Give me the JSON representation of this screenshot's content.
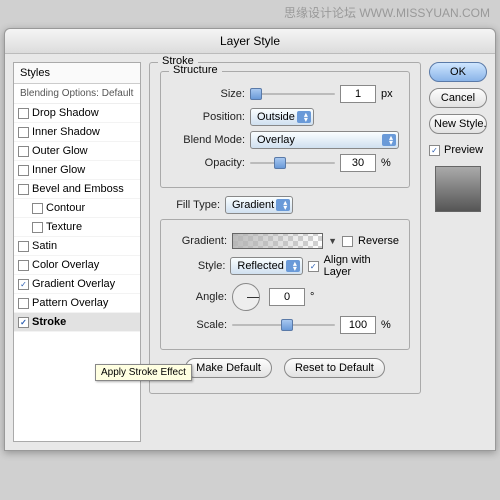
{
  "watermark": "思缘设计论坛 WWW.MISSYUAN.COM",
  "windowTitle": "Layer Style",
  "styles": {
    "header": "Styles",
    "sub": "Blending Options: Default",
    "items": [
      {
        "label": "Drop Shadow",
        "checked": false
      },
      {
        "label": "Inner Shadow",
        "checked": false
      },
      {
        "label": "Outer Glow",
        "checked": false
      },
      {
        "label": "Inner Glow",
        "checked": false
      },
      {
        "label": "Bevel and Emboss",
        "checked": false
      },
      {
        "label": "Contour",
        "checked": false,
        "indent": true
      },
      {
        "label": "Texture",
        "checked": false,
        "indent": true
      },
      {
        "label": "Satin",
        "checked": false
      },
      {
        "label": "Color Overlay",
        "checked": false
      },
      {
        "label": "Gradient Overlay",
        "checked": true
      },
      {
        "label": "Pattern Overlay",
        "checked": false
      },
      {
        "label": "Stroke",
        "checked": true,
        "selected": true
      }
    ],
    "tooltip": "Apply Stroke Effect"
  },
  "stroke": {
    "legend": "Stroke",
    "structure": {
      "legend": "Structure",
      "sizeLabel": "Size:",
      "sizeValue": "1",
      "sizeUnit": "px",
      "positionLabel": "Position:",
      "positionValue": "Outside",
      "blendLabel": "Blend Mode:",
      "blendValue": "Overlay",
      "opacityLabel": "Opacity:",
      "opacityValue": "30",
      "opacityUnit": "%"
    },
    "fill": {
      "fillTypeLabel": "Fill Type:",
      "fillTypeValue": "Gradient",
      "gradientLabel": "Gradient:",
      "reverseLabel": "Reverse",
      "styleLabel": "Style:",
      "styleValue": "Reflected",
      "alignLabel": "Align with Layer",
      "angleLabel": "Angle:",
      "angleValue": "0",
      "angleUnit": "°",
      "scaleLabel": "Scale:",
      "scaleValue": "100",
      "scaleUnit": "%"
    },
    "buttons": {
      "makeDefault": "Make Default",
      "reset": "Reset to Default"
    }
  },
  "right": {
    "ok": "OK",
    "cancel": "Cancel",
    "newStyle": "New Style...",
    "preview": "Preview"
  }
}
